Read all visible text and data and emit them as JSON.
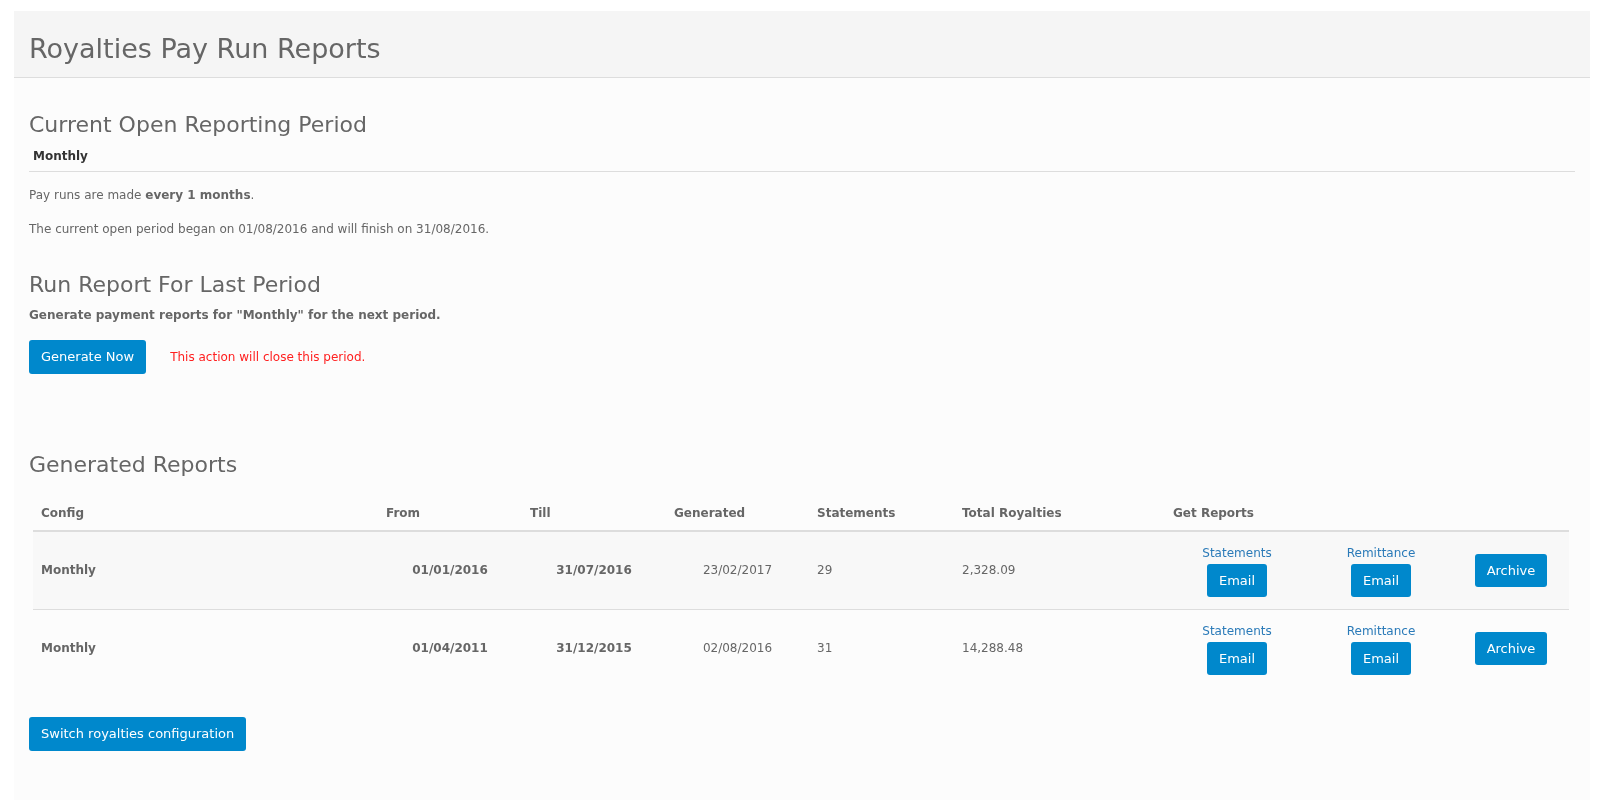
{
  "page": {
    "title": "Royalties Pay Run Reports"
  },
  "current_period": {
    "heading": "Current Open Reporting Period",
    "config_name": "Monthly",
    "frequency_text": "Pay runs are made **every 1 months**.",
    "period_text": "The current open period began on 01/08/2016 and will finish on 31/08/2016."
  },
  "run_report": {
    "heading": "Run Report For Last Period",
    "description": "Generate payment reports for \"Monthly\" for the next period.",
    "button": "Generate Now",
    "warning": "This action will close this period."
  },
  "generated_reports": {
    "heading": "Generated Reports",
    "columns": [
      "Config",
      "From",
      "Till",
      "Generated",
      "Statements",
      "Total Royalties",
      "Get Reports"
    ],
    "rows": [
      {
        "config": "Monthly",
        "from": "01/01/2016",
        "till": "31/07/2016",
        "generated": "23/02/2017",
        "statements": "29",
        "total_royalties": "2,328.09",
        "statements_link": "Statements",
        "statements_email": "Email",
        "remittance_link": "Remittance",
        "remittance_email": "Email",
        "archive": "Archive"
      },
      {
        "config": "Monthly",
        "from": "01/04/2011",
        "till": "31/12/2015",
        "generated": "02/08/2016",
        "statements": "31",
        "total_royalties": "14,288.48",
        "statements_link": "Statements",
        "statements_email": "Email",
        "remittance_link": "Remittance",
        "remittance_email": "Email",
        "archive": "Archive"
      }
    ]
  },
  "switch_button": "Switch royalties configuration"
}
